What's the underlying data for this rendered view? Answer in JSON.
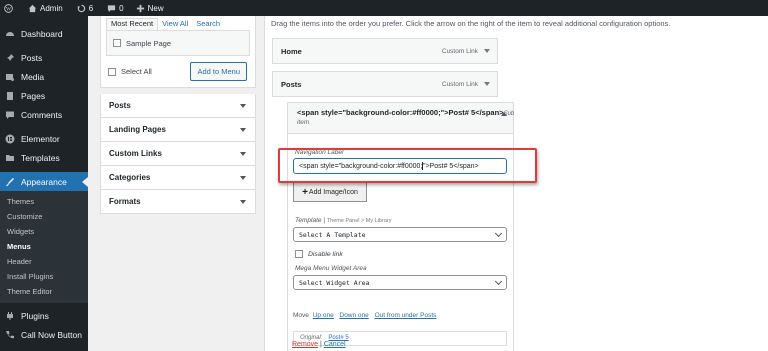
{
  "adminbar": {
    "site_name": "Admin",
    "updates_count": "6",
    "comments_count": "0",
    "new_label": "New"
  },
  "sidebar": {
    "items": [
      {
        "label": "Dashboard",
        "icon": "dashboard-icon"
      },
      {
        "label": "Posts",
        "icon": "pin-icon"
      },
      {
        "label": "Media",
        "icon": "media-icon"
      },
      {
        "label": "Pages",
        "icon": "pages-icon"
      },
      {
        "label": "Comments",
        "icon": "comment-icon"
      },
      {
        "label": "Elementor",
        "icon": "elementor-icon"
      },
      {
        "label": "Templates",
        "icon": "folder-icon"
      },
      {
        "label": "Appearance",
        "icon": "brush-icon"
      }
    ],
    "submenu": [
      "Themes",
      "Customize",
      "Widgets",
      "Menus",
      "Header",
      "Install Plugins",
      "Theme Editor"
    ],
    "bottom_items": [
      {
        "label": "Plugins",
        "icon": "plugin-icon"
      },
      {
        "label": "Call Now Button",
        "icon": "phone-icon"
      }
    ]
  },
  "pages_panel": {
    "tabs": [
      "Most Recent",
      "View All",
      "Search"
    ],
    "item": "Sample Page",
    "select_all": "Select All",
    "add_button": "Add to Menu"
  },
  "accordion": [
    "Posts",
    "Landing Pages",
    "Custom Links",
    "Categories",
    "Formats"
  ],
  "structure": {
    "instructions": "Drag the items into the order you prefer. Click the arrow on the right of the item to reveal additional configuration options.",
    "items": [
      {
        "title": "Home",
        "type": "Custom Link"
      },
      {
        "title": "Posts",
        "type": "Custom Link"
      }
    ],
    "open_item": {
      "title": "<span style=\"background-color:#ff0000;\">Post# 5</span>",
      "type_suffix": "Sub",
      "type_line2": "item"
    }
  },
  "settings": {
    "nav_label_caption": "Navigation Label",
    "nav_label_before_caret": "<span style=\"background-color:#ff0000;",
    "nav_label_after_caret": "\">Post# 5</span>",
    "add_image_button": "Add Image/Icon",
    "template_caption": "Template",
    "template_note": "Theme Panel > My Library",
    "template_select": "Select A Template",
    "disable_link": "Disable link",
    "mega_caption": "Mega Menu Widget Area",
    "mega_select": "Select Widget Area",
    "move_label": "Move",
    "move_links": [
      "Up one",
      "Down one",
      "Out from under Posts"
    ],
    "original_label": "Original:",
    "original_link": "Post# 5",
    "remove": "Remove",
    "separator": "|",
    "cancel": "Cancel"
  },
  "colors": {
    "accent": "#2271b1",
    "sidebar_bg": "#1d2327",
    "highlight": "#e03a3a",
    "remove": "#d63638"
  }
}
